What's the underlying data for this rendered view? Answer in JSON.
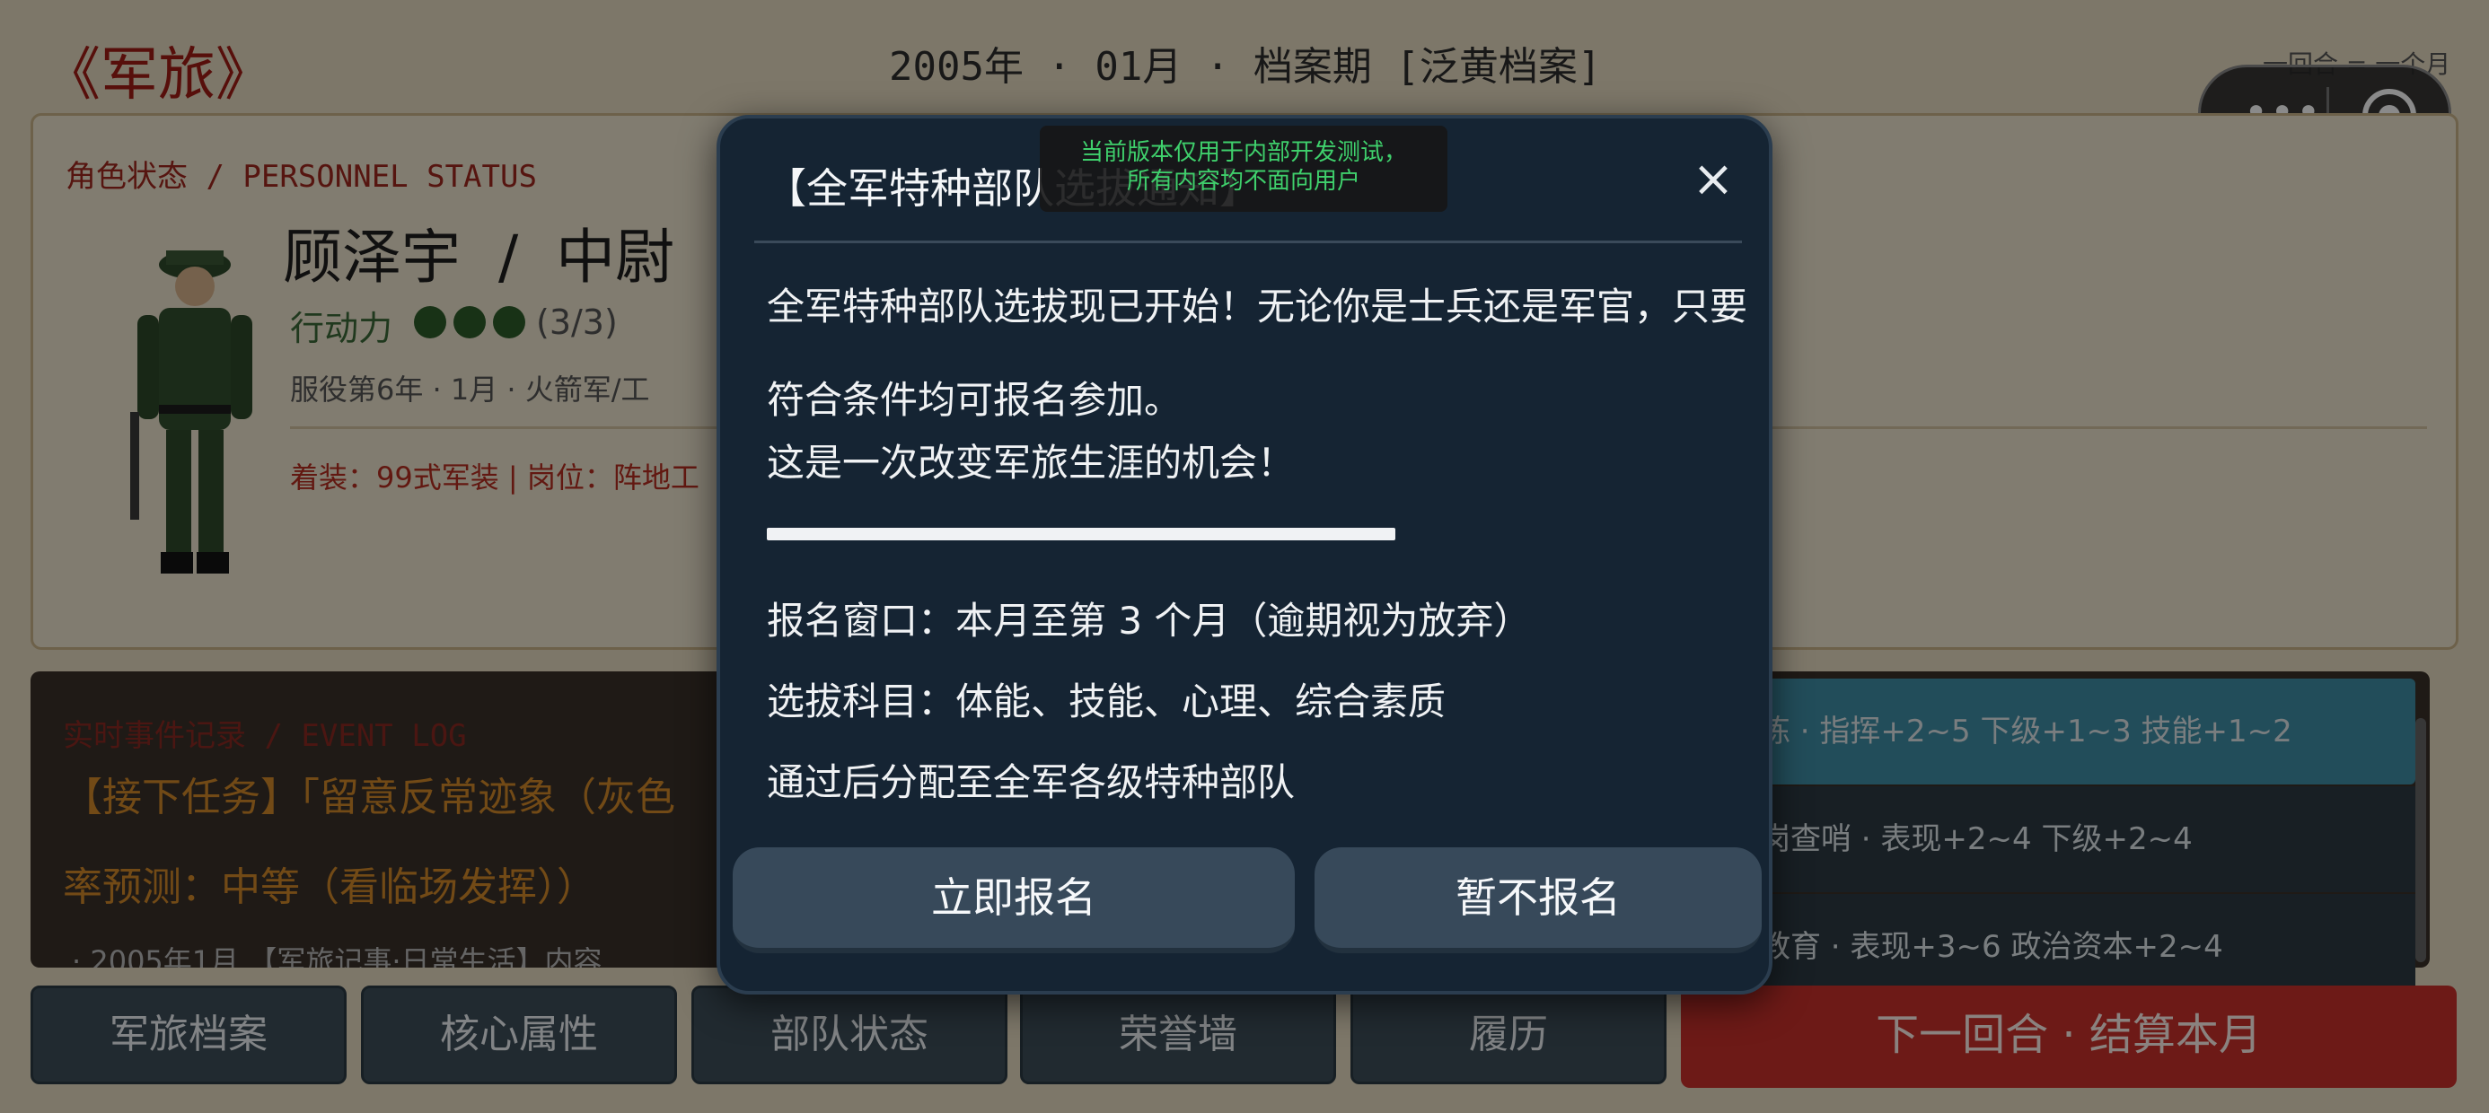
{
  "header": {
    "game_title": "《军旅》",
    "date_line": "2005年 · 01月 · 档案期 [泛黄档案]",
    "turn_hint": "一回合 = 一个月"
  },
  "status": {
    "section_label": "角色状态 / PERSONNEL STATUS",
    "name_rank": "顾泽宇  /  中尉",
    "action_label": "行动力",
    "action_points": 3,
    "action_count": "(3/3)",
    "service_line": "服役第6年 · 1月 · 火箭军/工",
    "attire_line": "着装：99式军装 | 岗位：阵地工"
  },
  "event_log": {
    "label": "实时事件记录 / EVENT LOG",
    "task_line": "【接下任务】「留意反常迹象（灰色",
    "predict_line": "率预测：中等（看临场发挥））",
    "entry_line": "· 2005年1月 【军旅记事·日常生活】内容"
  },
  "options": [
    "练 · 指挥+2~5 下级+1~3 技能+1~2",
    "岗查哨 · 表现+2~4 下级+2~4",
    "教育 · 表现+3~6 政治资本+2~4"
  ],
  "nav": {
    "items": [
      "军旅档案",
      "核心属性",
      "部队状态",
      "荣誉墙",
      "履历"
    ],
    "next_turn": "下一回合 · 结算本月"
  },
  "modal": {
    "title": "【全军特种部队选拔通知】",
    "close_icon": "×",
    "body_line1": "全军特种部队选拔现已开始！无论你是士兵还是军官，只要",
    "body_line2": "符合条件均可报名参加。",
    "body_line3": "这是一次改变军旅生涯的机会！",
    "window": "报名窗口：本月至第 3 个月（逾期视为放弃）",
    "subjects": "选拔科目：体能、技能、心理、综合素质",
    "assign": "通过后分配至全军各级特种部队",
    "apply_label": "立即报名",
    "skip_label": "暂不报名"
  },
  "dev_tip": {
    "line1": "当前版本仅用于内部开发测试，",
    "line2": "所有内容均不面向用户"
  },
  "colors": {
    "accent_red": "#c9302b",
    "modal_bg": "#152433",
    "tip_green": "#3fd06c"
  }
}
